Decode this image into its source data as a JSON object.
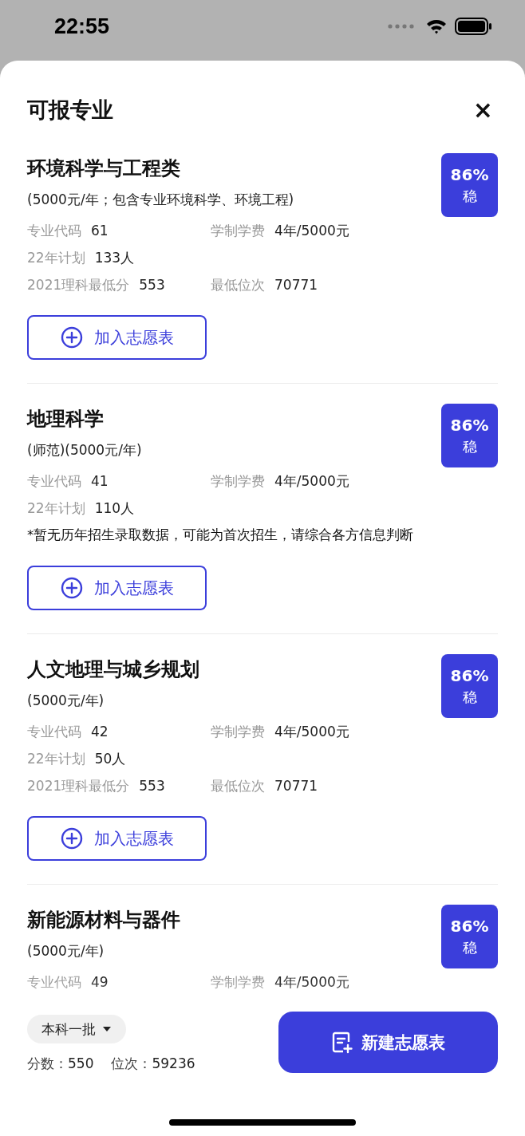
{
  "status_bar": {
    "time": "22:55"
  },
  "sheet": {
    "title": "可报专业",
    "close": "×"
  },
  "majors": [
    {
      "name": "环境科学与工程类",
      "detail": "(5000元/年；包含专业环境科学、环境工程)",
      "rows": [
        [
          {
            "label": "专业代码",
            "value": "61"
          },
          {
            "label": "学制学费",
            "value": "4年/5000元"
          }
        ],
        [
          {
            "label": "22年计划",
            "value": "133人"
          }
        ],
        [
          {
            "label": "2021理科最低分",
            "value": "553"
          },
          {
            "label": "最低位次",
            "value": "70771"
          }
        ]
      ],
      "probability": "86%",
      "tag": "稳",
      "button": "加入志愿表"
    },
    {
      "name": "地理科学",
      "detail": "(师范)(5000元/年)",
      "rows": [
        [
          {
            "label": "专业代码",
            "value": "41"
          },
          {
            "label": "学制学费",
            "value": "4年/5000元"
          }
        ],
        [
          {
            "label": "22年计划",
            "value": "110人"
          }
        ]
      ],
      "note": "*暂无历年招生录取数据，可能为首次招生，请综合各方信息判断",
      "probability": "86%",
      "tag": "稳",
      "button": "加入志愿表"
    },
    {
      "name": "人文地理与城乡规划",
      "detail": "(5000元/年)",
      "rows": [
        [
          {
            "label": "专业代码",
            "value": "42"
          },
          {
            "label": "学制学费",
            "value": "4年/5000元"
          }
        ],
        [
          {
            "label": "22年计划",
            "value": "50人"
          }
        ],
        [
          {
            "label": "2021理科最低分",
            "value": "553"
          },
          {
            "label": "最低位次",
            "value": "70771"
          }
        ]
      ],
      "probability": "86%",
      "tag": "稳",
      "button": "加入志愿表"
    },
    {
      "name": "新能源材料与器件",
      "detail": "(5000元/年)",
      "rows": [
        [
          {
            "label": "专业代码",
            "value": "49"
          },
          {
            "label": "学制学费",
            "value": "4年/5000元"
          }
        ]
      ],
      "probability": "86%",
      "tag": "稳"
    }
  ],
  "footer": {
    "batch": "本科一批",
    "score_label": "分数：",
    "score": "550",
    "rank_label": "位次：",
    "rank": "59236",
    "create_button": "新建志愿表"
  }
}
